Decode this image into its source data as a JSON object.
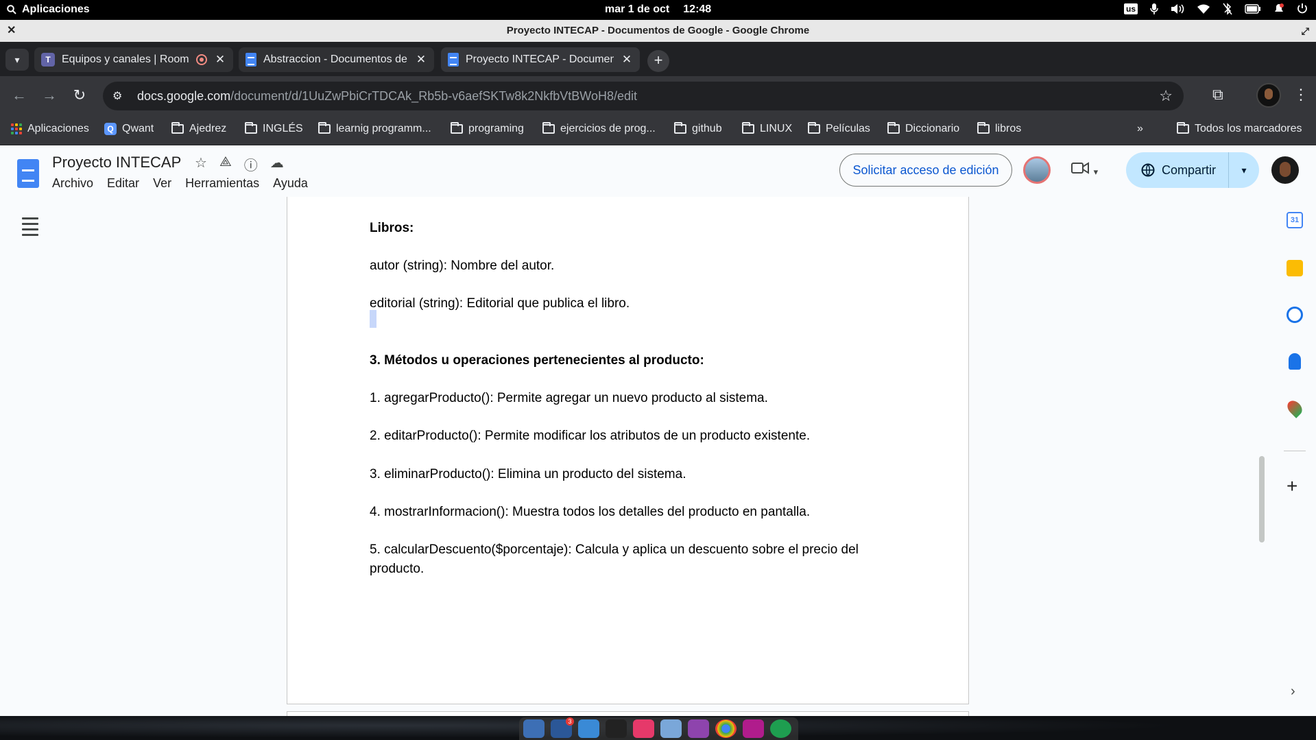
{
  "system": {
    "apps_label": "Aplicaciones",
    "date": "mar 1 de oct",
    "time": "12:48",
    "kbd_layout": "us"
  },
  "window": {
    "title": "Proyecto INTECAP - Documentos de Google - Google Chrome"
  },
  "tabs": [
    {
      "label": "Equipos y canales | Room",
      "icon": "teams-icon"
    },
    {
      "label": "Abstraccion - Documentos de",
      "icon": "docs-icon"
    },
    {
      "label": "Proyecto INTECAP - Documen",
      "icon": "docs-icon"
    }
  ],
  "omnibox": {
    "host": "docs.google.com",
    "path": "/document/d/1UuZwPbiCrTDCAk_Rb5b-v6aefSKTw8k2NkfbVtBWoH8/edit"
  },
  "bookmarks": {
    "items": [
      {
        "label": "Aplicaciones",
        "icon": "apps-grid-icon"
      },
      {
        "label": "Qwant",
        "icon": "qwant-icon"
      },
      {
        "label": "Ajedrez",
        "icon": "folder-icon"
      },
      {
        "label": "INGLÉS",
        "icon": "folder-icon"
      },
      {
        "label": "learnig programm...",
        "icon": "folder-icon"
      },
      {
        "label": "programing",
        "icon": "folder-icon"
      },
      {
        "label": "ejercicios de prog...",
        "icon": "folder-icon"
      },
      {
        "label": "github",
        "icon": "folder-icon"
      },
      {
        "label": "LINUX",
        "icon": "folder-icon"
      },
      {
        "label": "Películas",
        "icon": "folder-icon"
      },
      {
        "label": "Diccionario",
        "icon": "folder-icon"
      },
      {
        "label": "libros",
        "icon": "folder-icon"
      }
    ],
    "overflow": "»",
    "all_bookmarks": "Todos los marcadores"
  },
  "docs": {
    "title": "Proyecto INTECAP",
    "menus": [
      "Archivo",
      "Editar",
      "Ver",
      "Herramientas",
      "Ayuda"
    ],
    "request_edit": "Solicitar acceso de edición",
    "share": "Compartir"
  },
  "document": {
    "lines": [
      "Libros:",
      "autor (string): Nombre del autor.",
      "editorial (string): Editorial que publica el libro.",
      "3. Métodos u operaciones pertenecientes al producto:",
      "1. agregarProducto(): Permite agregar un nuevo producto al sistema.",
      "2. editarProducto(): Permite modificar los atributos de un producto existente.",
      "3. eliminarProducto(): Elimina un producto del sistema.",
      "4. mostrarInformacion(): Muestra todos los detalles del producto en pantalla.",
      "5. calcularDescuento($porcentaje): Calcula y aplica un descuento sobre el precio del producto."
    ]
  },
  "side_panel": {
    "calendar_day": "31"
  },
  "dock": {
    "mail_badge": "3"
  },
  "colors": {
    "docs_blue": "#4285f4",
    "share_bg": "#c2e7ff",
    "link_blue": "#0b57d0",
    "chrome_dark": "#35363a"
  }
}
